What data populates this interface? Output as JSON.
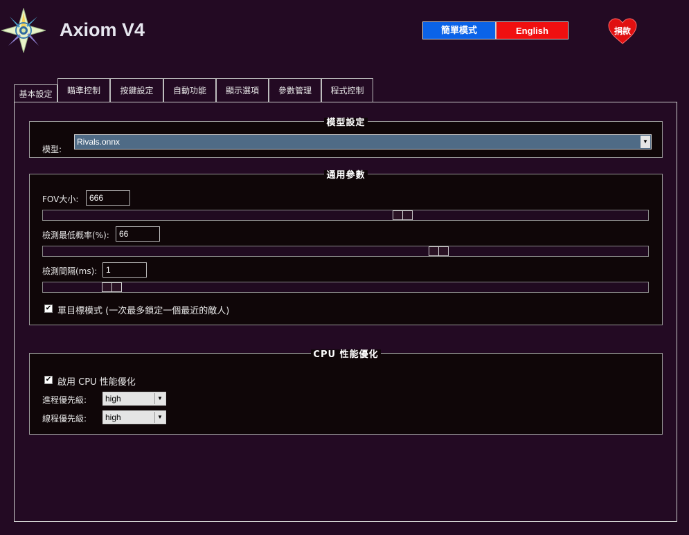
{
  "header": {
    "app_title": "Axiom V4",
    "simple_mode_label": "簡單模式",
    "english_label": "English",
    "donate_label": "捐款",
    "logo_icon": "star-compass-icon",
    "donate_icon": "heart-icon"
  },
  "tabs": [
    {
      "label": "基本設定",
      "active": true
    },
    {
      "label": "瞄準控制"
    },
    {
      "label": "按鍵設定"
    },
    {
      "label": "自動功能"
    },
    {
      "label": "顯示選項"
    },
    {
      "label": "參數管理"
    },
    {
      "label": "程式控制"
    }
  ],
  "model_group": {
    "title": "模型設定",
    "model_label": "模型:",
    "model_value": "Rivals.onnx"
  },
  "general_group": {
    "title": "通用參數",
    "fov_label": "FOV大小:",
    "fov_value": "666",
    "confidence_label": "檢測最低概率(%):",
    "confidence_value": "66",
    "interval_label": "檢測間隔(ms):",
    "interval_value": "1",
    "single_target_label": "單目標模式 (一次最多鎖定一個最近的敵人)",
    "single_target_checked": true,
    "sliders": {
      "fov_fraction": 0.6,
      "confidence_fraction": 0.66,
      "interval_fraction": 0.1
    }
  },
  "cpu_group": {
    "title": "CPU 性能優化",
    "enable_label": "啟用 CPU 性能優化",
    "enable_checked": true,
    "process_priority_label": "進程優先級:",
    "process_priority_value": "high",
    "thread_priority_label": "線程優先級:",
    "thread_priority_value": "high"
  },
  "colors": {
    "background": "#230a23",
    "simple_mode_button": "#0b63e8",
    "english_button": "#f01010",
    "donate_heart": "#e01010",
    "selected_model": "#4f6b86"
  }
}
